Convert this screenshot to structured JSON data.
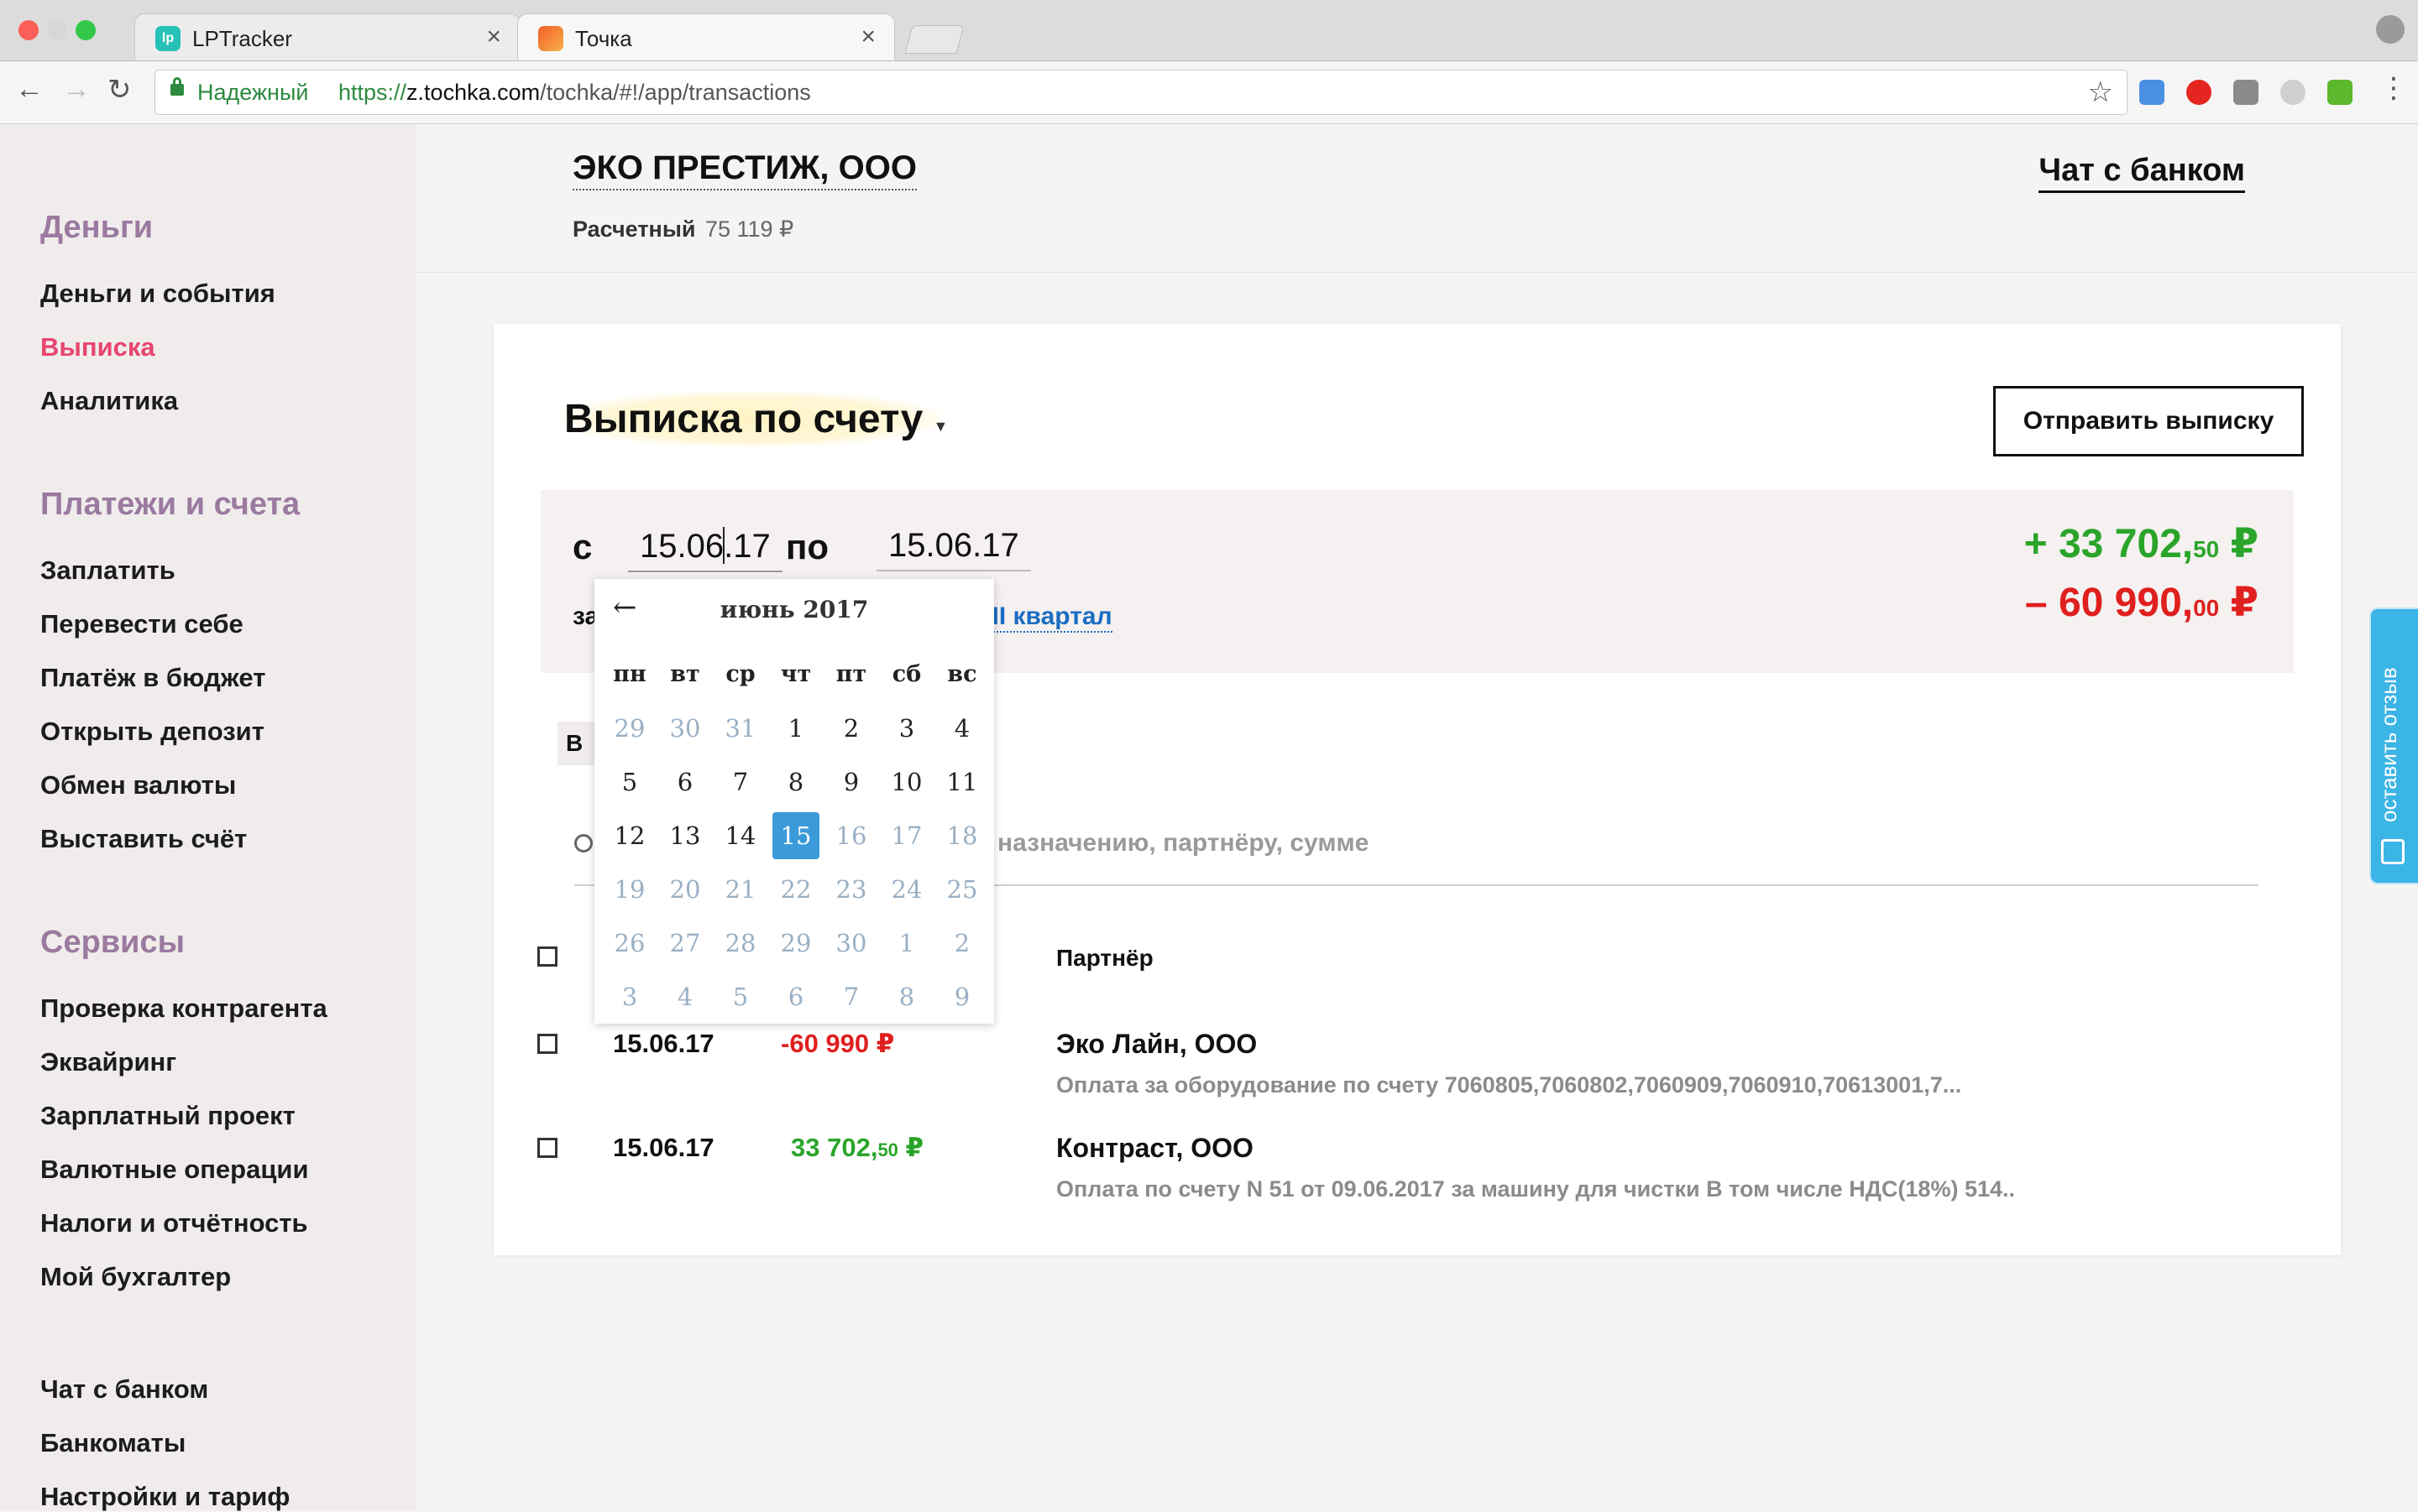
{
  "browser": {
    "tabs": [
      {
        "title": "LPTracker",
        "favicon": "lp-logo-icon",
        "active": false
      },
      {
        "title": "Точка",
        "favicon": "tochka-logo-icon",
        "active": true
      }
    ],
    "secure_label": "Надежный",
    "url_proto": "https://",
    "url_host": "z.tochka.com",
    "url_path": "/tochka/#!/app/transactions"
  },
  "sidebar": {
    "sections": [
      {
        "heading": "Деньги",
        "items": [
          "Деньги и события",
          "Выписка",
          "Аналитика"
        ]
      },
      {
        "heading": "Платежи и счета",
        "items": [
          "Заплатить",
          "Перевести себе",
          "Платёж в бюджет",
          "Открыть депозит",
          "Обмен валюты",
          "Выставить счёт"
        ]
      },
      {
        "heading": "Сервисы",
        "items": [
          "Проверка контрагента",
          "Эквайринг",
          "Зарплатный проект",
          "Валютные операции",
          "Налоги и отчётность",
          "Мой бухгалтер"
        ]
      }
    ],
    "footer_items": [
      "Чат с банком",
      "Банкоматы",
      "Настройки и тариф"
    ],
    "active_item": "Выписка"
  },
  "header": {
    "company": "ЭКО ПРЕСТИЖ, ООО",
    "account_label": "Расчетный",
    "account_balance": "75 119 ₽",
    "chat_link": "Чат с банком"
  },
  "statement": {
    "title": "Выписка по счету",
    "send_button": "Отправить выписку",
    "from_label": "с",
    "date_from_a": "15.06",
    "date_from_b": ".17",
    "to_label": "по",
    "date_to": "15.06.17",
    "period_prefix": "за",
    "quarter_link": "за II квартал",
    "income_main": "+ 33 702,",
    "income_cents": "50",
    "income_currency": " ₽",
    "outcome_main": "– 60 990,",
    "outcome_cents": "00",
    "outcome_currency": " ₽",
    "tab_all_fragment": "В",
    "search_placeholder_fragment": "назначению, партнёру, сумме",
    "column_partner": "Партнёр",
    "transactions": [
      {
        "date": "15.06.17",
        "amount_main": "-60 990",
        "amount_cents": "",
        "currency": " ₽",
        "type": "outgoing",
        "partner": "Эко Лайн, ООО",
        "description": "Оплата за оборудование по счету 7060805,7060802,7060909,7060910,70613001,7..."
      },
      {
        "date": "15.06.17",
        "amount_main": "33 702,",
        "amount_cents": "50",
        "currency": " ₽",
        "type": "incoming",
        "partner": "Контраст, ООО",
        "description": "Оплата по счету N 51 от 09.06.2017 за машину для чистки В том числе НДС(18%) 514.."
      }
    ]
  },
  "calendar": {
    "prev_arrow": "←",
    "month_title": "июнь 2017",
    "weekdays": [
      "пн",
      "вт",
      "ср",
      "чт",
      "пт",
      "сб",
      "вс"
    ],
    "weeks": [
      [
        "29",
        "30",
        "31",
        "1",
        "2",
        "3",
        "4"
      ],
      [
        "5",
        "6",
        "7",
        "8",
        "9",
        "10",
        "11"
      ],
      [
        "12",
        "13",
        "14",
        "15",
        "16",
        "17",
        "18"
      ],
      [
        "19",
        "20",
        "21",
        "22",
        "23",
        "24",
        "25"
      ],
      [
        "26",
        "27",
        "28",
        "29",
        "30",
        "1",
        "2"
      ],
      [
        "3",
        "4",
        "5",
        "6",
        "7",
        "8",
        "9"
      ]
    ],
    "selected_day": "15",
    "in_month_enabled_through": "15"
  },
  "feedback_tab": "оставить отзыв",
  "colors": {
    "accent_pink": "#e8456f",
    "heading_purple": "#9b7aa0",
    "income_green": "#2aa52a",
    "outcome_red": "#e01f1f",
    "link_blue": "#1a6dc2",
    "calendar_selected": "#3b9ad9",
    "feedback_blue": "#3bb4e6"
  }
}
